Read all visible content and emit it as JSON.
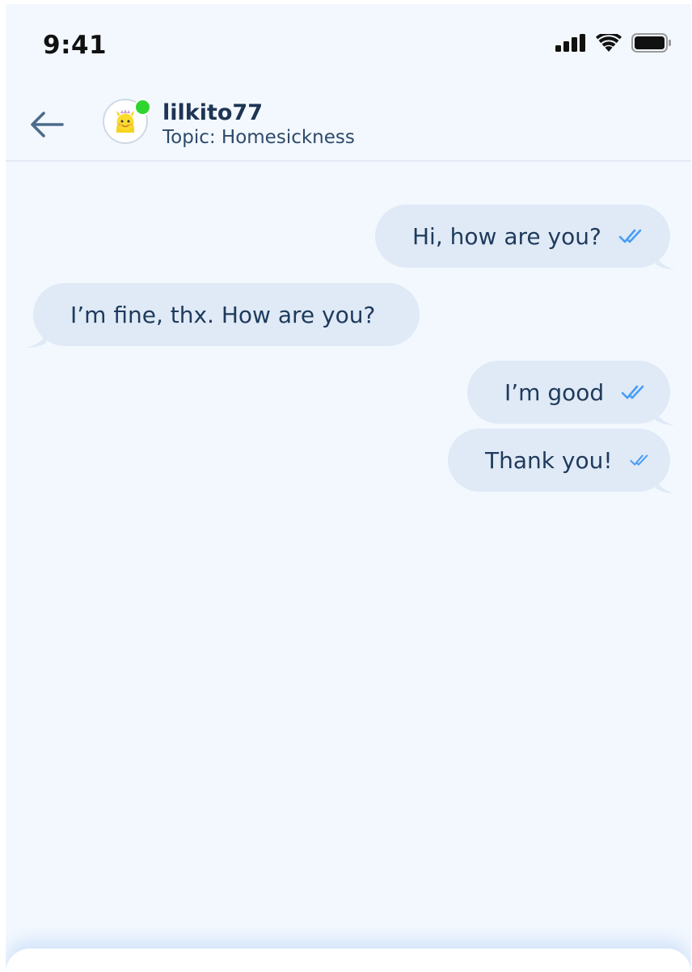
{
  "status_bar": {
    "time": "9:41",
    "icons": [
      "cellular-signal-icon",
      "wifi-icon",
      "battery-icon"
    ]
  },
  "header": {
    "back_icon": "arrow-left-icon",
    "contact_name": "lilkito77",
    "topic": "Topic: Homesickness",
    "online": true,
    "avatar_icon": "yellow-creature-avatar"
  },
  "messages": [
    {
      "direction": "out",
      "text": "Hi, how are you?",
      "read_icon": "double-check-icon"
    },
    {
      "direction": "in",
      "text": "I’m fine, thx. How are you?"
    },
    {
      "direction": "out",
      "text": "I’m good",
      "read_icon": "double-check-icon"
    },
    {
      "direction": "out",
      "text": "Thank you!",
      "read_icon": "double-check-icon"
    }
  ],
  "colors": {
    "background": "#f3f8fe",
    "bubble": "#dfeaf6",
    "text": "#1f3a5c",
    "read_check": "#4a9cf5",
    "online": "#2ed52e"
  }
}
